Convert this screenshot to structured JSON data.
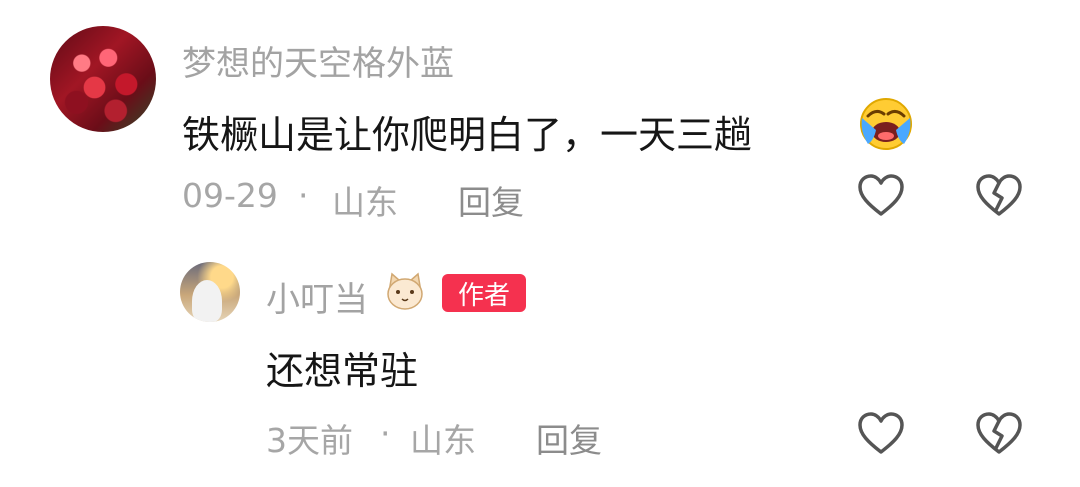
{
  "comments": [
    {
      "username": "梦想的天空格外蓝",
      "text": "铁橛山是让你爬明白了，一天三趟",
      "emoji": "loudly-crying-face-emoji",
      "date": "09-29",
      "separator": "·",
      "location": "山东",
      "reply_label": "回复",
      "icons": [
        "heart-icon",
        "broken-heart-icon"
      ]
    },
    {
      "username": "小叮当",
      "name_emoji": "cat-face-emoji",
      "badge": "作者",
      "text": "还想常驻",
      "date": "3天前",
      "separator": "·",
      "location": "山东",
      "reply_label": "回复",
      "icons": [
        "heart-icon",
        "broken-heart-icon"
      ]
    }
  ],
  "colors": {
    "username": "#a3a3a3",
    "comment_text": "#161616",
    "meta": "#a6a6a6",
    "badge_bg": "#f5314f",
    "icon_stroke": "#555555"
  }
}
